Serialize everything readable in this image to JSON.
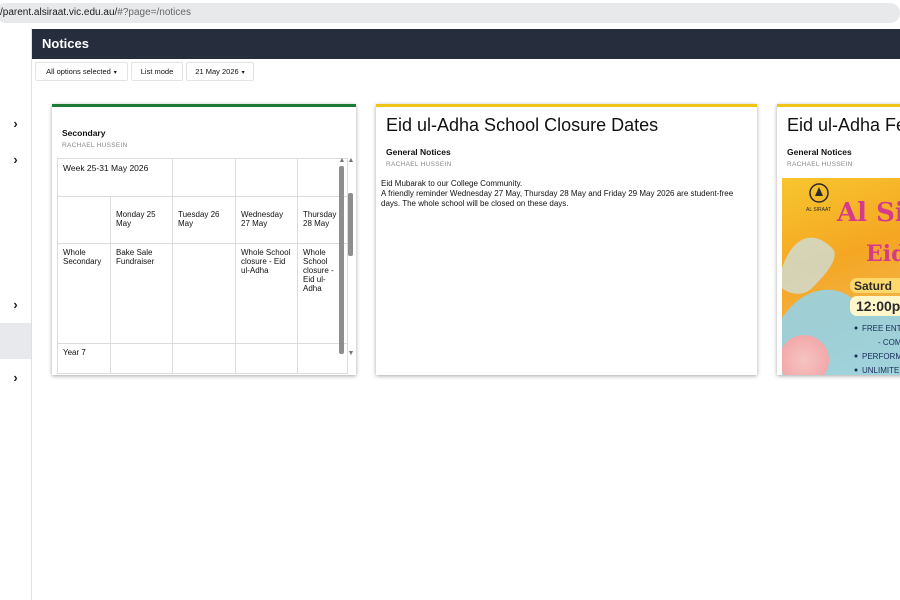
{
  "browser": {
    "url_host": "/parent.alsiraat.vic.edu.au/",
    "url_rest": "#?page=/notices"
  },
  "page": {
    "title": "Notices"
  },
  "toolbar": {
    "filter_label": "All options selected",
    "mode_label": "List mode",
    "date_label": "21 May 2026"
  },
  "notices": [
    {
      "category": "Secondary",
      "author": "RACHAEL HUSSEIN",
      "accent": "#1f7a36",
      "calendar": {
        "week_label": "Week 25-31 May 2026",
        "days": [
          "Monday 25 May",
          "Tuesday 26 May",
          "Wednesday 27 May",
          "Thursday 28 May"
        ],
        "rows": [
          {
            "group": "Whole Secondary",
            "cells": [
              "Bake Sale Fundraiser",
              "",
              "Whole School closure - Eid ul-Adha",
              "Whole School closure - Eid ul-Adha"
            ]
          },
          {
            "group": "Year 7",
            "cells": [
              "",
              "",
              "",
              ""
            ]
          }
        ]
      }
    },
    {
      "title": "Eid ul-Adha School Closure Dates",
      "category": "General Notices",
      "author": "RACHAEL HUSSEIN",
      "accent": "#f0c419",
      "body_line1": "Eid Mubarak to our College Community.",
      "body_line2": "A friendly reminder Wednesday 27 May, Thursday 28 May and Friday 29 May 2026 are student-free days. The whole school will be closed on these days."
    },
    {
      "title": "Eid ul-Adha Fe",
      "category": "General Notices",
      "author": "RACHAEL HUSSEIN",
      "accent": "#f0c419",
      "poster": {
        "logo_text": "AL SIRAAT",
        "headline": "Al Sir",
        "sub": "Eid",
        "date_banner": "Saturd",
        "time_banner": "12:00p",
        "bullets": [
          "FREE ENT",
          "- COM",
          "PERFORM",
          "UNLIMITE"
        ]
      }
    }
  ]
}
